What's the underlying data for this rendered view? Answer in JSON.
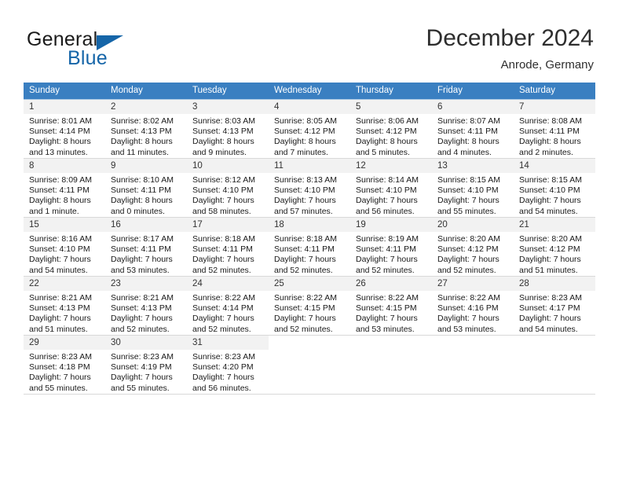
{
  "brand": {
    "name_part1": "General",
    "name_part2": "Blue",
    "accent_color": "#1565a8",
    "triangle_icon": "triangle-logo-icon"
  },
  "header": {
    "title": "December 2024",
    "location": "Anrode, Germany"
  },
  "theme": {
    "header_row_bg": "#3a7fc1",
    "header_row_text": "#ffffff",
    "daynum_bg": "#f2f2f2",
    "cell_border": "#a9c7e3"
  },
  "weekdays": [
    "Sunday",
    "Monday",
    "Tuesday",
    "Wednesday",
    "Thursday",
    "Friday",
    "Saturday"
  ],
  "weeks": [
    [
      {
        "day": "1",
        "l1": "Sunrise: 8:01 AM",
        "l2": "Sunset: 4:14 PM",
        "l3": "Daylight: 8 hours",
        "l4": "and 13 minutes."
      },
      {
        "day": "2",
        "l1": "Sunrise: 8:02 AM",
        "l2": "Sunset: 4:13 PM",
        "l3": "Daylight: 8 hours",
        "l4": "and 11 minutes."
      },
      {
        "day": "3",
        "l1": "Sunrise: 8:03 AM",
        "l2": "Sunset: 4:13 PM",
        "l3": "Daylight: 8 hours",
        "l4": "and 9 minutes."
      },
      {
        "day": "4",
        "l1": "Sunrise: 8:05 AM",
        "l2": "Sunset: 4:12 PM",
        "l3": "Daylight: 8 hours",
        "l4": "and 7 minutes."
      },
      {
        "day": "5",
        "l1": "Sunrise: 8:06 AM",
        "l2": "Sunset: 4:12 PM",
        "l3": "Daylight: 8 hours",
        "l4": "and 5 minutes."
      },
      {
        "day": "6",
        "l1": "Sunrise: 8:07 AM",
        "l2": "Sunset: 4:11 PM",
        "l3": "Daylight: 8 hours",
        "l4": "and 4 minutes."
      },
      {
        "day": "7",
        "l1": "Sunrise: 8:08 AM",
        "l2": "Sunset: 4:11 PM",
        "l3": "Daylight: 8 hours",
        "l4": "and 2 minutes."
      }
    ],
    [
      {
        "day": "8",
        "l1": "Sunrise: 8:09 AM",
        "l2": "Sunset: 4:11 PM",
        "l3": "Daylight: 8 hours",
        "l4": "and 1 minute."
      },
      {
        "day": "9",
        "l1": "Sunrise: 8:10 AM",
        "l2": "Sunset: 4:11 PM",
        "l3": "Daylight: 8 hours",
        "l4": "and 0 minutes."
      },
      {
        "day": "10",
        "l1": "Sunrise: 8:12 AM",
        "l2": "Sunset: 4:10 PM",
        "l3": "Daylight: 7 hours",
        "l4": "and 58 minutes."
      },
      {
        "day": "11",
        "l1": "Sunrise: 8:13 AM",
        "l2": "Sunset: 4:10 PM",
        "l3": "Daylight: 7 hours",
        "l4": "and 57 minutes."
      },
      {
        "day": "12",
        "l1": "Sunrise: 8:14 AM",
        "l2": "Sunset: 4:10 PM",
        "l3": "Daylight: 7 hours",
        "l4": "and 56 minutes."
      },
      {
        "day": "13",
        "l1": "Sunrise: 8:15 AM",
        "l2": "Sunset: 4:10 PM",
        "l3": "Daylight: 7 hours",
        "l4": "and 55 minutes."
      },
      {
        "day": "14",
        "l1": "Sunrise: 8:15 AM",
        "l2": "Sunset: 4:10 PM",
        "l3": "Daylight: 7 hours",
        "l4": "and 54 minutes."
      }
    ],
    [
      {
        "day": "15",
        "l1": "Sunrise: 8:16 AM",
        "l2": "Sunset: 4:10 PM",
        "l3": "Daylight: 7 hours",
        "l4": "and 54 minutes."
      },
      {
        "day": "16",
        "l1": "Sunrise: 8:17 AM",
        "l2": "Sunset: 4:11 PM",
        "l3": "Daylight: 7 hours",
        "l4": "and 53 minutes."
      },
      {
        "day": "17",
        "l1": "Sunrise: 8:18 AM",
        "l2": "Sunset: 4:11 PM",
        "l3": "Daylight: 7 hours",
        "l4": "and 52 minutes."
      },
      {
        "day": "18",
        "l1": "Sunrise: 8:18 AM",
        "l2": "Sunset: 4:11 PM",
        "l3": "Daylight: 7 hours",
        "l4": "and 52 minutes."
      },
      {
        "day": "19",
        "l1": "Sunrise: 8:19 AM",
        "l2": "Sunset: 4:11 PM",
        "l3": "Daylight: 7 hours",
        "l4": "and 52 minutes."
      },
      {
        "day": "20",
        "l1": "Sunrise: 8:20 AM",
        "l2": "Sunset: 4:12 PM",
        "l3": "Daylight: 7 hours",
        "l4": "and 52 minutes."
      },
      {
        "day": "21",
        "l1": "Sunrise: 8:20 AM",
        "l2": "Sunset: 4:12 PM",
        "l3": "Daylight: 7 hours",
        "l4": "and 51 minutes."
      }
    ],
    [
      {
        "day": "22",
        "l1": "Sunrise: 8:21 AM",
        "l2": "Sunset: 4:13 PM",
        "l3": "Daylight: 7 hours",
        "l4": "and 51 minutes."
      },
      {
        "day": "23",
        "l1": "Sunrise: 8:21 AM",
        "l2": "Sunset: 4:13 PM",
        "l3": "Daylight: 7 hours",
        "l4": "and 52 minutes."
      },
      {
        "day": "24",
        "l1": "Sunrise: 8:22 AM",
        "l2": "Sunset: 4:14 PM",
        "l3": "Daylight: 7 hours",
        "l4": "and 52 minutes."
      },
      {
        "day": "25",
        "l1": "Sunrise: 8:22 AM",
        "l2": "Sunset: 4:15 PM",
        "l3": "Daylight: 7 hours",
        "l4": "and 52 minutes."
      },
      {
        "day": "26",
        "l1": "Sunrise: 8:22 AM",
        "l2": "Sunset: 4:15 PM",
        "l3": "Daylight: 7 hours",
        "l4": "and 53 minutes."
      },
      {
        "day": "27",
        "l1": "Sunrise: 8:22 AM",
        "l2": "Sunset: 4:16 PM",
        "l3": "Daylight: 7 hours",
        "l4": "and 53 minutes."
      },
      {
        "day": "28",
        "l1": "Sunrise: 8:23 AM",
        "l2": "Sunset: 4:17 PM",
        "l3": "Daylight: 7 hours",
        "l4": "and 54 minutes."
      }
    ],
    [
      {
        "day": "29",
        "l1": "Sunrise: 8:23 AM",
        "l2": "Sunset: 4:18 PM",
        "l3": "Daylight: 7 hours",
        "l4": "and 55 minutes."
      },
      {
        "day": "30",
        "l1": "Sunrise: 8:23 AM",
        "l2": "Sunset: 4:19 PM",
        "l3": "Daylight: 7 hours",
        "l4": "and 55 minutes."
      },
      {
        "day": "31",
        "l1": "Sunrise: 8:23 AM",
        "l2": "Sunset: 4:20 PM",
        "l3": "Daylight: 7 hours",
        "l4": "and 56 minutes."
      },
      {
        "day": "",
        "l1": "",
        "l2": "",
        "l3": "",
        "l4": ""
      },
      {
        "day": "",
        "l1": "",
        "l2": "",
        "l3": "",
        "l4": ""
      },
      {
        "day": "",
        "l1": "",
        "l2": "",
        "l3": "",
        "l4": ""
      },
      {
        "day": "",
        "l1": "",
        "l2": "",
        "l3": "",
        "l4": ""
      }
    ]
  ]
}
